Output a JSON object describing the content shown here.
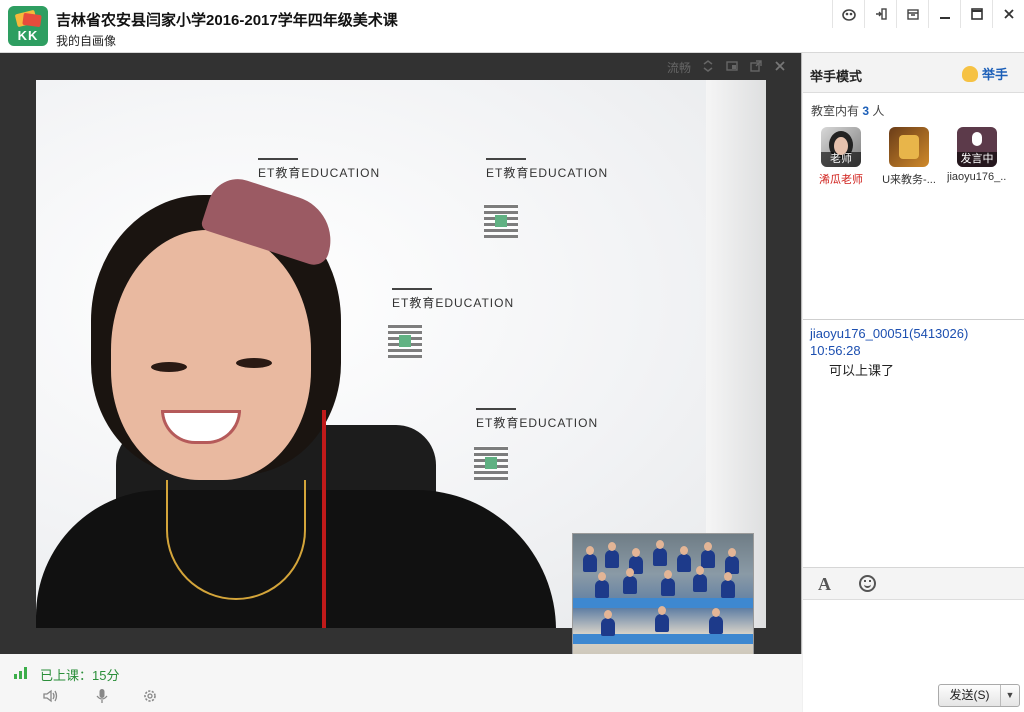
{
  "window": {
    "title": "吉林省农安县闫家小学2016-2017学年四年级美术课",
    "subtitle": "我的自画像",
    "logo_text": "KK",
    "controls": [
      "skin-icon",
      "detach-icon",
      "box-icon",
      "minimize-icon",
      "maximize-icon",
      "close-icon"
    ]
  },
  "video": {
    "toolbar": {
      "quality_label": "流畅"
    },
    "banner_text": "ET教育EDUCATION"
  },
  "status": {
    "class_time": "已上课：15分"
  },
  "side": {
    "raise_mode_title": "举手模式",
    "raise_button_label": "举手",
    "room_count_prefix": "教室内有",
    "room_count_value": "3",
    "room_count_suffix": "人",
    "members": [
      {
        "name": "浠瓜老师",
        "badge": "老师"
      },
      {
        "name": "U来教务-...",
        "badge": ""
      },
      {
        "name": "jiaoyu176_...",
        "badge": "发言中"
      }
    ],
    "chat": {
      "sender": "jiaoyu176_00051(5413026)",
      "time": "10:56:28",
      "message": "可以上课了"
    },
    "input": {
      "send_label": "发送(S)"
    }
  }
}
